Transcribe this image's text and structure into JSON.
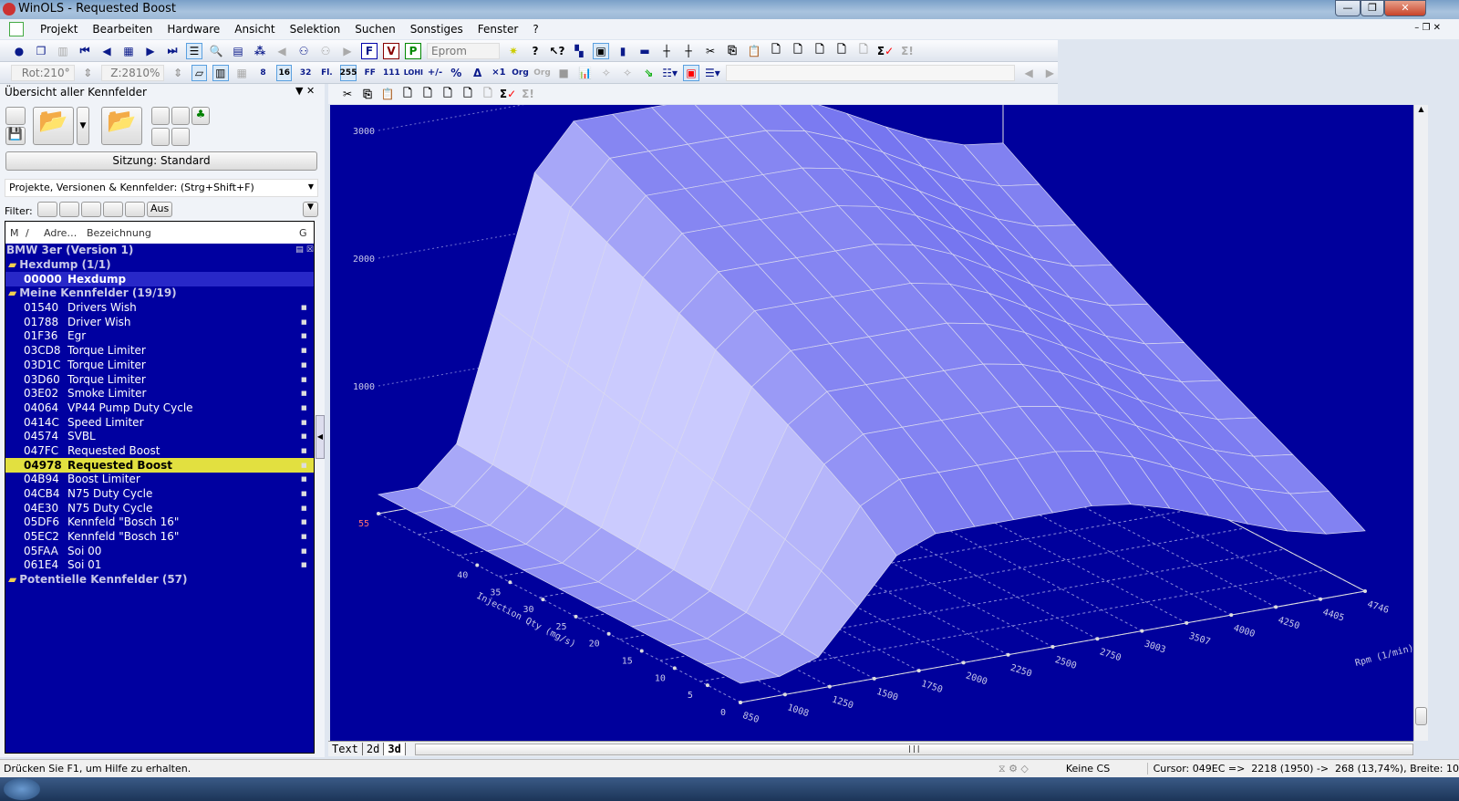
{
  "window": {
    "title": "WinOLS - Requested Boost",
    "minimize": "—",
    "maximize": "❐",
    "close": "✕"
  },
  "menu": [
    "Projekt",
    "Bearbeiten",
    "Hardware",
    "Ansicht",
    "Selektion",
    "Suchen",
    "Sonstiges",
    "Fenster",
    "?"
  ],
  "toolbar": {
    "eprom_label": "Eprom",
    "rot": "Rot:210°",
    "zoom": "Z:2810%",
    "bits": [
      "8",
      "16",
      "32",
      "Fl."
    ],
    "formats": [
      "255",
      "FF",
      "111",
      "LOHI",
      "+/-",
      "%",
      "Δ",
      "×1",
      "Org",
      "Org"
    ]
  },
  "panel": {
    "title": "Übersicht aller Kennfelder",
    "session_button": "Sitzung: Standard",
    "search_dropdown": "Projekte, Versionen & Kennfelder: (Strg+Shift+F)",
    "filter_label": "Filter:",
    "filter_off": "Aus",
    "columns": {
      "m": "M",
      "sort": "/",
      "address": "Adre…",
      "name": "Bezeichnung",
      "g": "G"
    },
    "project": "BMW 3er (Version 1)",
    "groups": [
      {
        "label": "Hexdump (1/1)",
        "items": [
          {
            "address": "00000",
            "name": "Hexdump",
            "state": "highlight"
          }
        ]
      },
      {
        "label": "Meine Kennfelder (19/19)",
        "items": [
          {
            "address": "01540",
            "name": "Drivers Wish"
          },
          {
            "address": "01788",
            "name": "Driver Wish"
          },
          {
            "address": "01F36",
            "name": "Egr"
          },
          {
            "address": "03CD8",
            "name": "Torque Limiter"
          },
          {
            "address": "03D1C",
            "name": "Torque Limiter"
          },
          {
            "address": "03D60",
            "name": "Torque Limiter"
          },
          {
            "address": "03E02",
            "name": "Smoke Limiter"
          },
          {
            "address": "04064",
            "name": "VP44 Pump Duty Cycle"
          },
          {
            "address": "0414C",
            "name": "Speed Limiter"
          },
          {
            "address": "04574",
            "name": "SVBL"
          },
          {
            "address": "047FC",
            "name": "Requested Boost"
          },
          {
            "address": "04978",
            "name": "Requested Boost",
            "state": "selected"
          },
          {
            "address": "04B94",
            "name": "Boost Limiter"
          },
          {
            "address": "04CB4",
            "name": "N75 Duty Cycle"
          },
          {
            "address": "04E30",
            "name": "N75 Duty Cycle"
          },
          {
            "address": "05DF6",
            "name": "Kennfeld \"Bosch 16\""
          },
          {
            "address": "05EC2",
            "name": "Kennfeld \"Bosch 16\""
          },
          {
            "address": "05FAA",
            "name": "Soi 00"
          },
          {
            "address": "061E4",
            "name": "Soi 01"
          }
        ]
      },
      {
        "label": "Potentielle Kennfelder (57)",
        "items": []
      }
    ]
  },
  "chart_data": {
    "type": "surface3d",
    "z_ticks": [
      "1000",
      "2000",
      "3000"
    ],
    "x_label": "Rpm (1/min)",
    "x_ticks": [
      "850",
      "1008",
      "1250",
      "1500",
      "1750",
      "2000",
      "2250",
      "2500",
      "2750",
      "3003",
      "3507",
      "4000",
      "4250",
      "4405",
      "4746"
    ],
    "y_label": "Injection Qty (mg/s)",
    "y_ticks": [
      "0",
      "5",
      "10",
      "15",
      "20",
      "25",
      "30",
      "35",
      "40",
      "55"
    ],
    "colors": {
      "background": "#00009c",
      "surface": "#5a5af0",
      "grid": "#e0e0e0"
    }
  },
  "tabs": [
    "Text",
    "2d",
    "3d"
  ],
  "active_tab": "3d",
  "status": {
    "help": "Drücken Sie F1, um Hilfe zu erhalten.",
    "cs": "Keine CS",
    "cursor": "Cursor: 049EC =>  2218 (1950) ->  268 (13,74%), Breite: 10"
  }
}
